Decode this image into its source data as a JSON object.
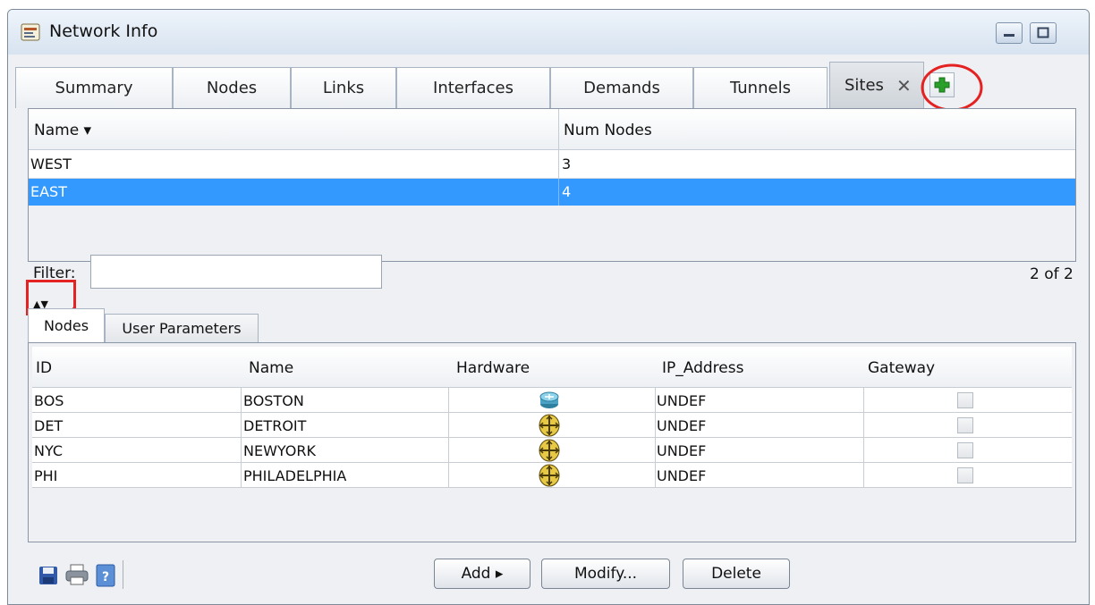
{
  "window": {
    "title": "Network Info"
  },
  "tabs": [
    {
      "label": "Summary"
    },
    {
      "label": "Nodes"
    },
    {
      "label": "Links"
    },
    {
      "label": "Interfaces"
    },
    {
      "label": "Demands"
    },
    {
      "label": "Tunnels"
    },
    {
      "label": "Sites",
      "active": true,
      "closable": true
    }
  ],
  "add_tab_icon": "plus-icon",
  "sites_table": {
    "columns": [
      "Name ▾",
      "Num Nodes"
    ],
    "rows": [
      {
        "name": "WEST",
        "num_nodes": "3",
        "selected": false
      },
      {
        "name": "EAST",
        "num_nodes": "4",
        "selected": true
      }
    ]
  },
  "filter": {
    "label": "Filter:",
    "value": "",
    "count": "2 of 2"
  },
  "subtabs": [
    {
      "label": "Nodes",
      "active": true
    },
    {
      "label": "User Parameters"
    }
  ],
  "nodes_table": {
    "columns": [
      "ID",
      "Name",
      "Hardware",
      "IP_Address",
      "Gateway"
    ],
    "rows": [
      {
        "id": "BOS",
        "name": "BOSTON",
        "hardware": "router-icon",
        "ip": "UNDEF",
        "gateway": false
      },
      {
        "id": "DET",
        "name": "DETROIT",
        "hardware": "switch-icon",
        "ip": "UNDEF",
        "gateway": false
      },
      {
        "id": "NYC",
        "name": "NEWYORK",
        "hardware": "switch-icon",
        "ip": "UNDEF",
        "gateway": false
      },
      {
        "id": "PHI",
        "name": "PHILADELPHIA",
        "hardware": "switch-icon",
        "ip": "UNDEF",
        "gateway": false
      }
    ]
  },
  "buttons": {
    "add": "Add ▸",
    "modify": "Modify...",
    "delete": "Delete"
  },
  "colors": {
    "selection": "#3399ff",
    "annotation": "#e52222",
    "plus": "#2aa02a"
  }
}
